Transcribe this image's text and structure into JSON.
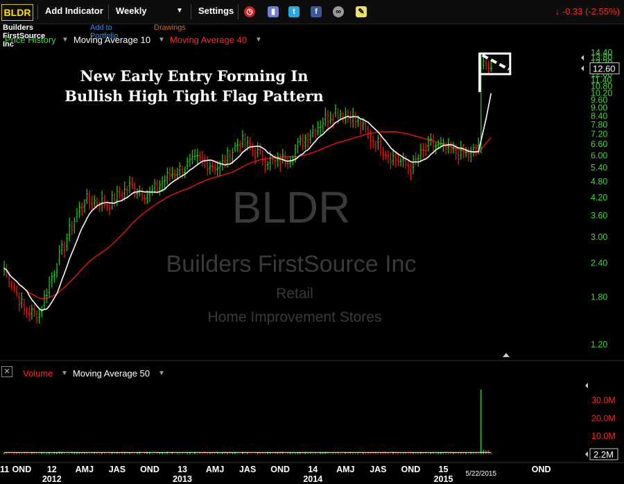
{
  "toolbar": {
    "ticker": "BLDR",
    "add_indicator": "Add Indicator",
    "timeframe": "Weekly",
    "settings": "Settings",
    "change": "-0.33 (-2.55%)"
  },
  "subbar": {
    "company": "Builders FirstSource Inc",
    "add_to_portfolio": "Add to Portfolio",
    "drawings": "Drawings"
  },
  "legend": {
    "price_history": "Price History",
    "ma10": "Moving Average 10",
    "ma40": "Moving Average 40"
  },
  "annotation": {
    "line1": "New Early Entry Forming In",
    "line2": "Bullish High Tight Flag Pattern"
  },
  "watermark": {
    "ticker": "BLDR",
    "company": "Builders FirstSource Inc",
    "sector": "Retail",
    "industry": "Home Improvement Stores"
  },
  "volume_panel": {
    "label": "Volume",
    "ma50": "Moving Average 50",
    "current": "2.2M"
  },
  "colors": {
    "up": "#18c818",
    "down": "#e01818",
    "ma10": "#ffffff",
    "ma40": "#d01515",
    "axis_green": "#3ddc3d"
  },
  "chart_data": [
    {
      "type": "candlestick",
      "title": "Price History",
      "scale": "log",
      "ylim": [
        1.0,
        15.5
      ],
      "y_ticks": [
        "14.40",
        "13.80",
        "13.20",
        "12.60",
        "12.00",
        "11.40",
        "10.80",
        "10.20",
        "9.60",
        "9.00",
        "8.40",
        "7.80",
        "7.20",
        "6.60",
        "6.00",
        "5.40",
        "4.80",
        "4.20",
        "3.60",
        "3.00",
        "2.40",
        "1.80",
        "1.20"
      ],
      "y_tick_values": [
        14.4,
        13.8,
        13.2,
        12.6,
        12.0,
        11.4,
        10.8,
        10.2,
        9.6,
        9.0,
        8.4,
        7.8,
        7.2,
        6.6,
        6.0,
        5.4,
        4.8,
        4.2,
        3.6,
        3.0,
        2.4,
        1.8,
        1.2
      ],
      "current_price_label": "12.60",
      "current_price": 12.6,
      "x_ticks": [
        {
          "label": "11",
          "index": 0
        },
        {
          "label": "OND",
          "index": 7
        },
        {
          "label": "12",
          "index": 19
        },
        {
          "label": "AMJ",
          "index": 32
        },
        {
          "label": "JAS",
          "index": 45
        },
        {
          "label": "OND",
          "index": 58
        },
        {
          "label": "13",
          "index": 71
        },
        {
          "label": "AMJ",
          "index": 84
        },
        {
          "label": "JAS",
          "index": 97
        },
        {
          "label": "OND",
          "index": 110
        },
        {
          "label": "14",
          "index": 123
        },
        {
          "label": "AMJ",
          "index": 136
        },
        {
          "label": "JAS",
          "index": 149
        },
        {
          "label": "OND",
          "index": 162
        },
        {
          "label": "15",
          "index": 175
        },
        {
          "label": "5/22/2015",
          "index": 190
        },
        {
          "label": "OND",
          "index": 214
        }
      ],
      "x_year_labels": [
        {
          "label": "2012",
          "index": 19
        },
        {
          "label": "2013",
          "index": 71
        },
        {
          "label": "2014",
          "index": 123
        },
        {
          "label": "2015",
          "index": 175
        }
      ],
      "anchors": [
        {
          "week": 0,
          "close": 2.3
        },
        {
          "week": 8,
          "close": 1.6
        },
        {
          "week": 14,
          "close": 1.55
        },
        {
          "week": 22,
          "close": 2.5
        },
        {
          "week": 32,
          "close": 4.1
        },
        {
          "week": 42,
          "close": 4.0
        },
        {
          "week": 50,
          "close": 4.6
        },
        {
          "week": 58,
          "close": 4.3
        },
        {
          "week": 66,
          "close": 5.1
        },
        {
          "week": 78,
          "close": 5.8
        },
        {
          "week": 86,
          "close": 5.4
        },
        {
          "week": 94,
          "close": 6.8
        },
        {
          "week": 102,
          "close": 6.0
        },
        {
          "week": 108,
          "close": 5.6
        },
        {
          "week": 114,
          "close": 6.0
        },
        {
          "week": 124,
          "close": 7.6
        },
        {
          "week": 132,
          "close": 8.8
        },
        {
          "week": 138,
          "close": 8.4
        },
        {
          "week": 146,
          "close": 7.0
        },
        {
          "week": 154,
          "close": 6.0
        },
        {
          "week": 162,
          "close": 5.4
        },
        {
          "week": 170,
          "close": 6.6
        },
        {
          "week": 178,
          "close": 6.2
        },
        {
          "week": 186,
          "close": 6.0
        },
        {
          "week": 189,
          "close": 6.6
        },
        {
          "week": 190,
          "close": 12.6
        },
        {
          "week": 191,
          "close": 13.4
        },
        {
          "week": 192,
          "close": 13.0
        },
        {
          "week": 193,
          "close": 12.6
        },
        {
          "week": 194,
          "close": 12.6
        }
      ],
      "series": [
        {
          "name": "Moving Average 10",
          "color": "#ffffff"
        },
        {
          "name": "Moving Average 40",
          "color": "#d01515"
        }
      ]
    },
    {
      "type": "bar",
      "title": "Volume",
      "ylim": [
        0,
        38
      ],
      "y_ticks": [
        "30.0M",
        "20.0M",
        "10.0M"
      ],
      "y_tick_values": [
        30,
        20,
        10
      ],
      "unit": "M",
      "base_volume": 0.8,
      "spikes": [
        {
          "week": 190,
          "value": 36.0
        },
        {
          "week": 191,
          "value": 2.5
        },
        {
          "week": 192,
          "value": 2.2
        },
        {
          "week": 193,
          "value": 2.2
        }
      ],
      "ma50_value": 1.0
    }
  ]
}
